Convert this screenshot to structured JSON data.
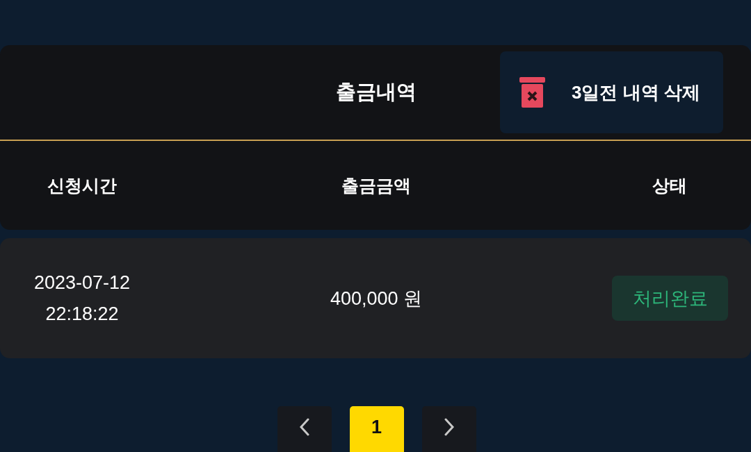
{
  "header": {
    "title": "출금내역",
    "delete_button": {
      "label": "3일전 내역 삭제"
    }
  },
  "table": {
    "columns": [
      "신청시간",
      "출금금액",
      "상태"
    ],
    "rows": [
      {
        "time": "2023-07-12 22:18:22",
        "amount": "400,000 원",
        "status": {
          "label": "처리완료",
          "kind": "completed"
        }
      }
    ]
  },
  "pagination": {
    "pages": [
      {
        "label": "1",
        "selected": true
      }
    ]
  }
}
